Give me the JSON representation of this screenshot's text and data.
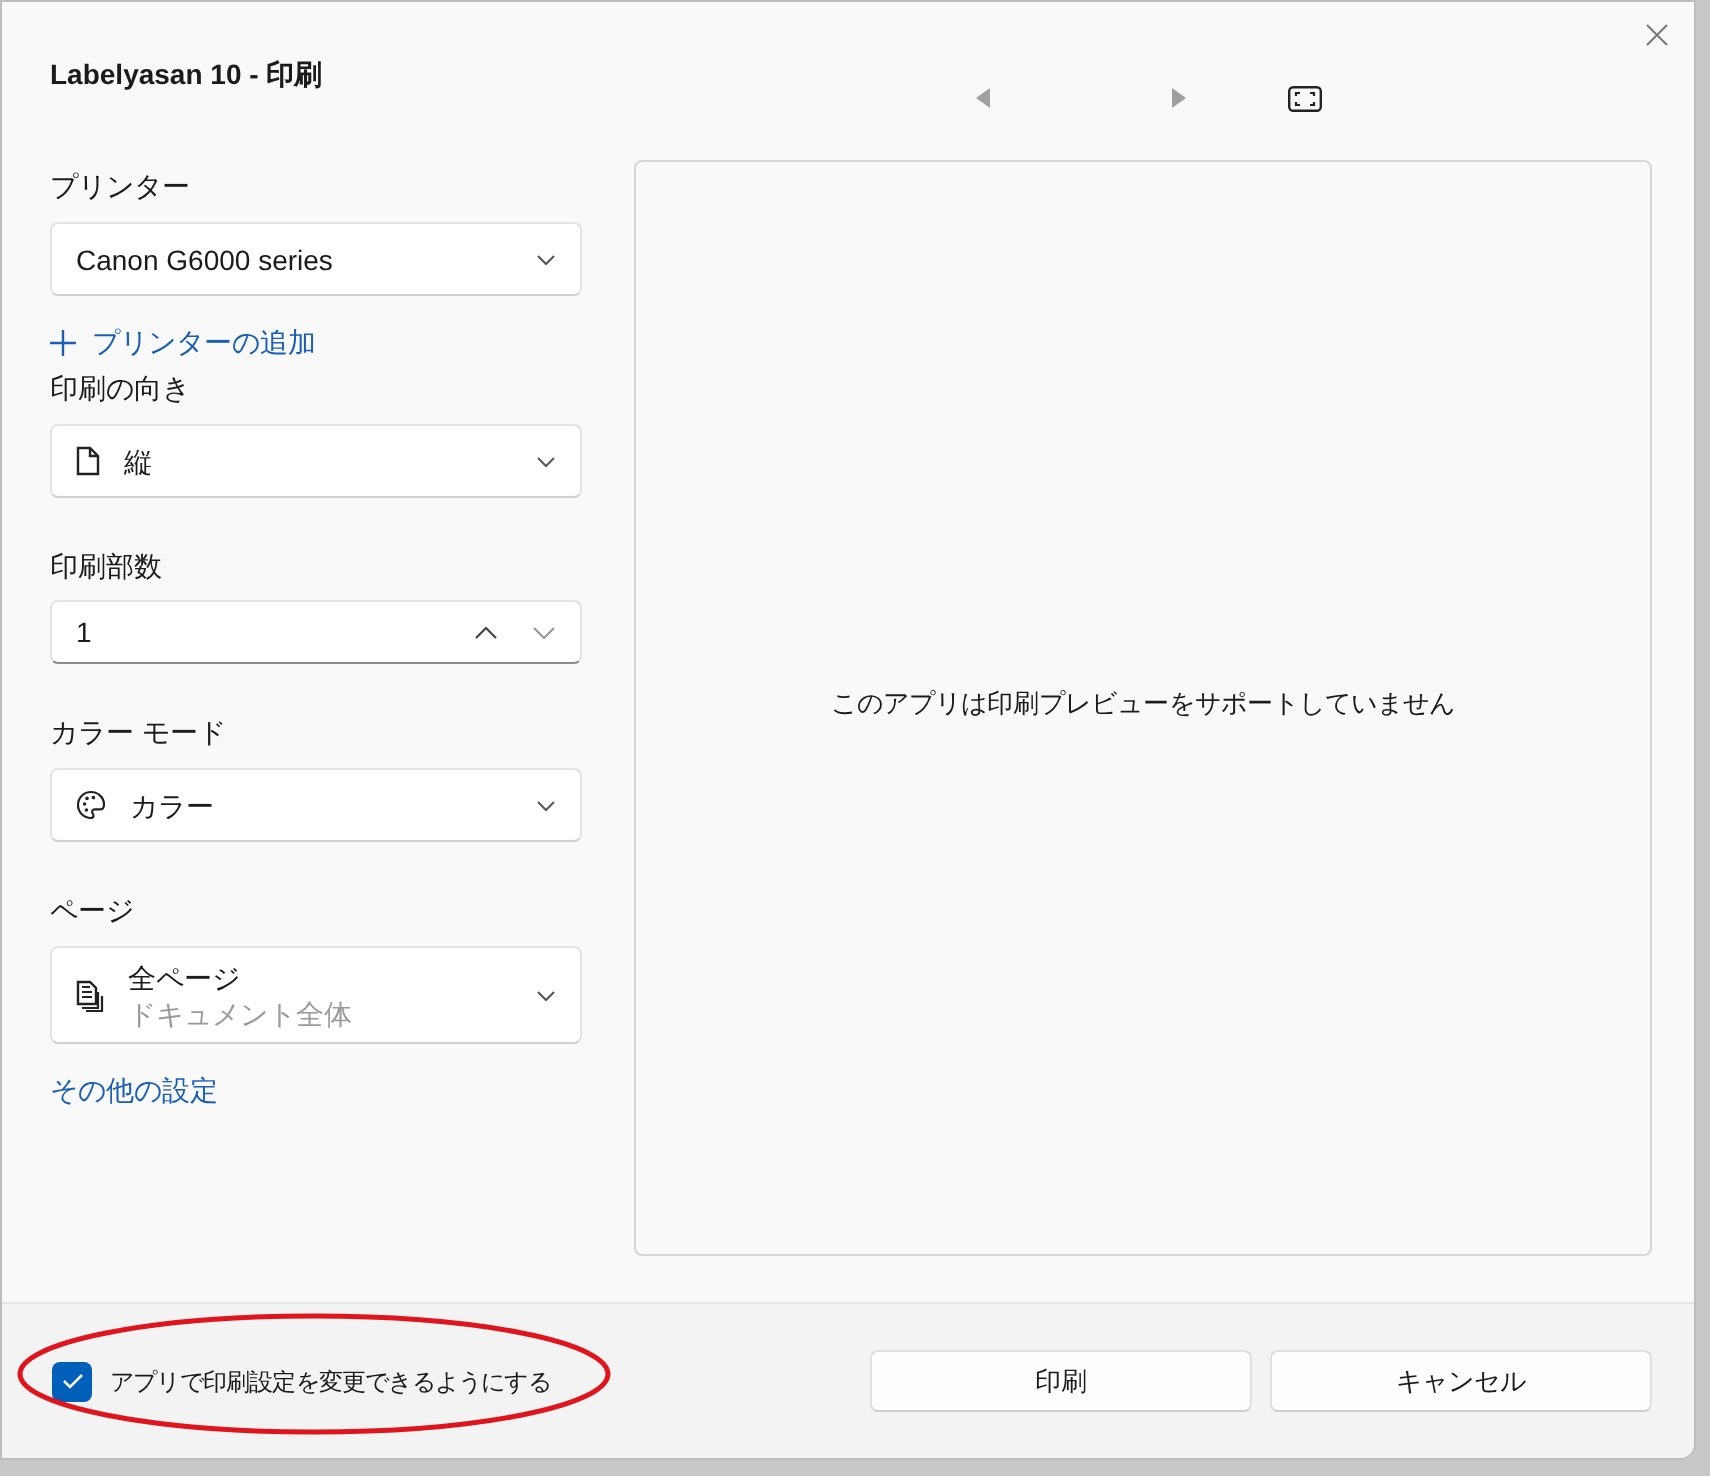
{
  "window": {
    "title": "Labelyasan 10 - 印刷"
  },
  "settings": [
    {
      "kind": "dropdown",
      "label": "プリンター",
      "value": "Canon G6000 series"
    },
    {
      "kind": "link",
      "value": "プリンターの追加"
    },
    {
      "kind": "dropdown",
      "label": "印刷の向き",
      "value": "縦"
    },
    {
      "kind": "number",
      "label": "印刷部数",
      "value": "1"
    },
    {
      "kind": "dropdown",
      "label": "カラー モード",
      "value": "カラー"
    },
    {
      "kind": "dropdown",
      "label": "ページ",
      "value": "全ページ",
      "subtext": "ドキュメント全体"
    },
    {
      "kind": "link",
      "value": "その他の設定"
    }
  ],
  "preview": {
    "message": "このアプリは印刷プレビューをサポートしていません"
  },
  "footer": {
    "checkbox": {
      "label": "アプリで印刷設定を変更できるようにする",
      "checked": true
    },
    "buttons": [
      "印刷",
      "キャンセル"
    ]
  }
}
